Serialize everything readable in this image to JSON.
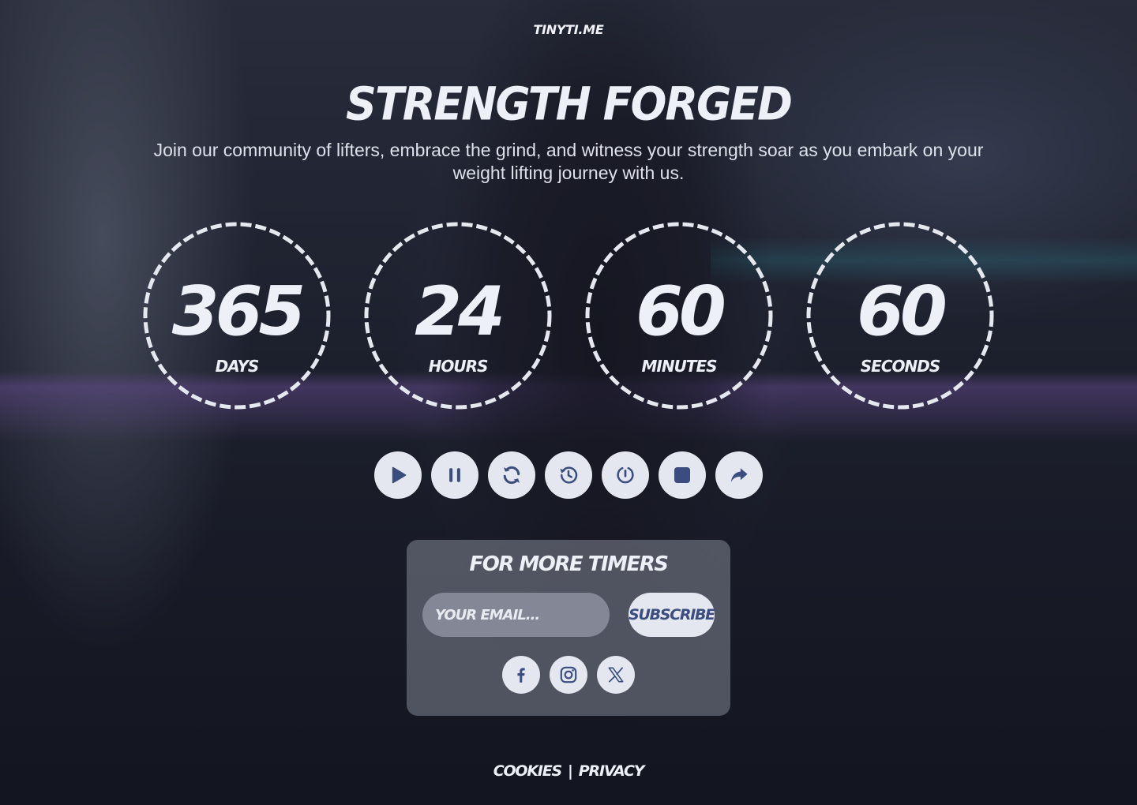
{
  "brand": "TINYTI.ME",
  "title": "STRENGTH FORGED",
  "subtitle": "Join our community of lifters, embrace the grind, and witness your strength soar as you embark on your weight lifting journey with us.",
  "timers": [
    {
      "value": "365",
      "label": "DAYS"
    },
    {
      "value": "24",
      "label": "HOURS"
    },
    {
      "value": "60",
      "label": "MINUTES"
    },
    {
      "value": "60",
      "label": "SECONDS"
    }
  ],
  "controls": [
    "play-icon",
    "pause-icon",
    "refresh-icon",
    "history-icon",
    "timer-reset-icon",
    "stop-icon",
    "share-icon"
  ],
  "subscribe_panel": {
    "title": "FOR MORE TIMERS",
    "email_placeholder": "YOUR EMAIL...",
    "button_label": "SUBSCRIBE",
    "social": [
      "facebook-icon",
      "instagram-icon",
      "x-icon"
    ]
  },
  "footer": {
    "cookies": "COOKIES",
    "separator": "|",
    "privacy": "PRIVACY"
  },
  "colors": {
    "text": "#eef0f7",
    "button_bg": "#e4e7f0",
    "icon": "#3b4d7e",
    "panel_bg": "rgba(130,134,148,0.55)"
  }
}
